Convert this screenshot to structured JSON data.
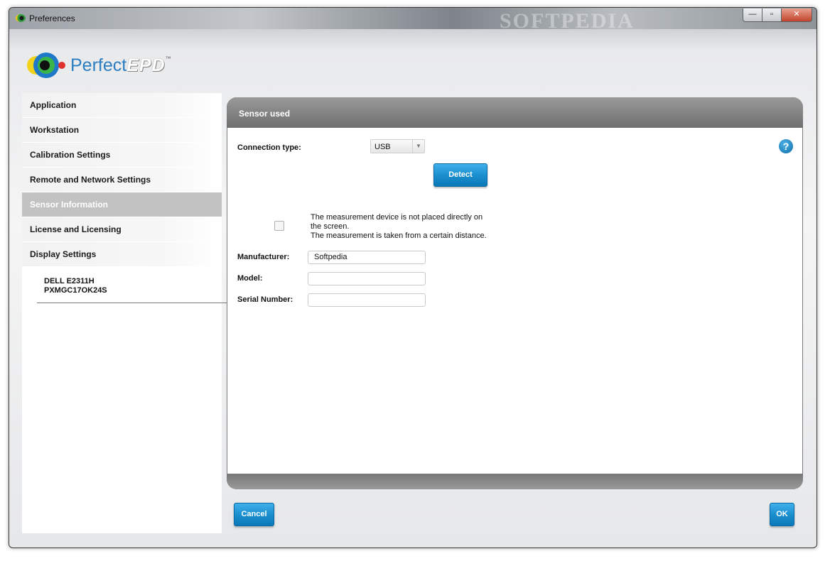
{
  "window": {
    "title": "Preferences",
    "watermark": "SOFTPEDIA",
    "controls": {
      "minimize": "—",
      "maximize": "▫",
      "close": "✕"
    }
  },
  "logo": {
    "perfect": "Perfect",
    "epd": "EPD",
    "tm": "™"
  },
  "sidebar": {
    "items": [
      {
        "label": "Application"
      },
      {
        "label": "Workstation"
      },
      {
        "label": "Calibration Settings"
      },
      {
        "label": "Remote and Network Settings"
      },
      {
        "label": "Sensor Information"
      },
      {
        "label": "License and Licensing"
      },
      {
        "label": "Display Settings"
      }
    ],
    "active_index": 4,
    "display_entry": {
      "line1": "DELL E2311H",
      "line2": "PXMGC17OK24S"
    }
  },
  "panel": {
    "title": "Sensor used",
    "connection_label": "Connection type:",
    "connection_value": "USB",
    "detect_label": "Detect",
    "help_symbol": "?",
    "checkbox_line1": "The measurement device is not placed directly on the screen.",
    "checkbox_line2": "The measurement is taken from a certain distance.",
    "checkbox_checked": false,
    "manufacturer_label": "Manufacturer:",
    "manufacturer_value": "Softpedia",
    "model_label": "Model:",
    "model_value": "",
    "serial_label": "Serial Number:",
    "serial_value": ""
  },
  "footer": {
    "cancel_label": "Cancel",
    "ok_label": "OK"
  },
  "colors": {
    "accent": "#1b8fcf",
    "active_nav": "#c2c2c2",
    "panel_header": "#7a7a7a"
  }
}
